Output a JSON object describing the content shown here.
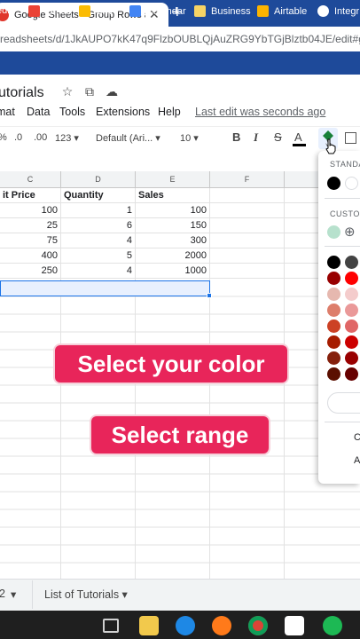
{
  "browser": {
    "tab_title": "Google Sheets - Group Rows and",
    "tab_close": "✕",
    "new_tab": "+",
    "address": "readsheets/d/1JkAUPO7kK47q9FlzbOUBLQjAuZRG9YbTGjBlztb04JE/edit#gid=5",
    "bookmarks": [
      "edia",
      "Gmail",
      "Drive",
      "Calendar",
      "Business",
      "Airtable",
      "Integr"
    ]
  },
  "sheets": {
    "doc_title": "utorials",
    "menu": [
      "mat",
      "Data",
      "Tools",
      "Extensions",
      "Help"
    ],
    "last_edit": "Last edit was seconds ago",
    "toolbar": {
      "percent": "%",
      "dec_dec": ".0",
      "dec_inc": ".00",
      "format": "123",
      "font": "Default (Ari...",
      "size": "10",
      "bold": "B",
      "italic": "I",
      "strike": "S",
      "font_color": "A"
    },
    "columns": [
      "C",
      "D",
      "E",
      "F"
    ],
    "header_row": [
      "it Price",
      "Quantity",
      "Sales"
    ],
    "rows": [
      [
        "100",
        "1",
        "100"
      ],
      [
        "25",
        "6",
        "150"
      ],
      [
        "75",
        "4",
        "300"
      ],
      [
        "400",
        "5",
        "2000"
      ],
      [
        "250",
        "4",
        "1000"
      ]
    ]
  },
  "overlays": {
    "select_color": "Select your color",
    "select_range": "Select range"
  },
  "color_panel": {
    "standard_label": "STANDA",
    "custom_label": "CUSTO",
    "add_symbol": "⊕",
    "partial_items": [
      "C",
      "A"
    ],
    "standard_colors": [
      "#000000",
      "#ffffff"
    ],
    "custom_colors": [
      "#b7e1cd"
    ],
    "palette": [
      [
        "#000000",
        "#434343"
      ],
      [
        "#980000",
        "#ff0000"
      ],
      [
        "#e6b8af",
        "#f4cccc"
      ],
      [
        "#dd7e6b",
        "#ea9999"
      ],
      [
        "#cc4125",
        "#e06666"
      ],
      [
        "#a61c00",
        "#cc0000"
      ],
      [
        "#85200c",
        "#990000"
      ],
      [
        "#5b0f00",
        "#660000"
      ]
    ]
  },
  "sheet_tabs": {
    "partial": "2",
    "active": "List of Tutorials"
  },
  "taskbar": {
    "icons": [
      "taskview-icon",
      "file-explorer-icon",
      "edge-icon",
      "firefox-icon",
      "chrome-icon",
      "notion-icon",
      "spotify-icon"
    ]
  }
}
